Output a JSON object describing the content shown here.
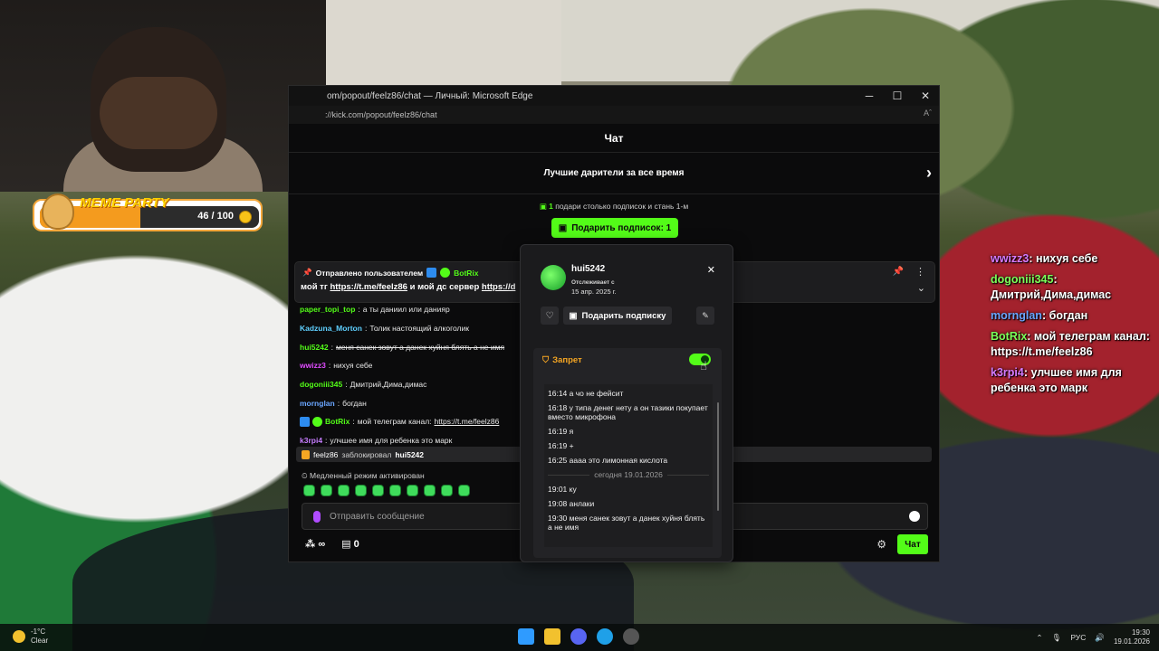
{
  "stream": {
    "meme_party": {
      "title": "MEME PARTY",
      "count": "46 / 100",
      "progress": 0.46
    },
    "overlay_chat": [
      {
        "user": "wwizz3",
        "text": "нихуя себе",
        "color": "#d67bff"
      },
      {
        "user": "dogoniii345",
        "text": "Дмитрий,Дима,димас",
        "color": "#7cff5a"
      },
      {
        "user": "mornglan",
        "text": "богдан",
        "color": "#6aa6ff"
      },
      {
        "user": "BotRix",
        "text": "мой телеграм канал: https://t.me/feelz86",
        "color": "#7cff5a"
      },
      {
        "user": "k3rpi4",
        "text": "улчшее имя для ребенка это марк",
        "color": "#d67bff"
      }
    ]
  },
  "browser": {
    "title": "om/popout/feelz86/chat — Личный: Microsoft Edge",
    "url": "://kick.com/popout/feelz86/chat",
    "reader_icon": "Aˆ"
  },
  "chat": {
    "title": "Чат",
    "top_gifters": "Лучшие дарители за все время",
    "promo_count": "1",
    "promo_text": "подари столько подписок и стань 1-м",
    "gift_button": "Подарить подписок: 1",
    "pinned": {
      "label": "Отправлено пользователем",
      "user": "BotRix",
      "text_start": "мой тг",
      "link1": "https://t.me/feelz86",
      "text_mid": "и мой дс сервер",
      "link2": "https://d"
    },
    "messages": [
      {
        "user": "paper_topi_top",
        "text": "а ты даниил или данияр",
        "color": "#53fc18"
      },
      {
        "user": "Kadzuna_Morton",
        "text": "Толик настоящий алкоголик",
        "color": "#5fd0ff"
      },
      {
        "user": "hui5242",
        "text": "меня санек зовут а данек хуйня блять а не имя",
        "color": "#53fc18",
        "struck": true
      },
      {
        "user": "wwizz3",
        "text": "нихуя себе",
        "color": "#e04cff"
      },
      {
        "user": "dogoniii345",
        "text": "Дмитрий,Дима,димас",
        "color": "#53fc18"
      },
      {
        "user": "mornglan",
        "text": "богдан",
        "color": "#6aa6ff"
      },
      {
        "user": "BotRix",
        "text": "мой телеграм канал:",
        "link": "https://t.me/feelz86",
        "color": "#53fc18"
      },
      {
        "user": "k3rpi4",
        "text": "улчшее имя для ребенка это марк",
        "color": "#c77dff"
      }
    ],
    "ban_notice": {
      "moderator": "feelz86",
      "action": "заблокировал",
      "target": "hui5242"
    },
    "slow_mode": "Медленный режим активирован",
    "input_placeholder": "Отправить сообщение",
    "footer": {
      "viewers": "∞",
      "store_count": "0",
      "send_label": "Чат"
    }
  },
  "user_card": {
    "username": "hui5242",
    "follow_label": "Отслеживает с",
    "follow_date": "15 апр. 2025 г.",
    "gift_button": "Подарить подписку",
    "ban_label": "Запрет",
    "ban_enabled": true,
    "history": [
      {
        "type": "msg",
        "text": "16:14 а чо не фейсит"
      },
      {
        "type": "msg",
        "text": "16:18 у типа денег нету а он тазики покупает вместо микрофона"
      },
      {
        "type": "msg",
        "text": "16:19 я"
      },
      {
        "type": "msg",
        "text": "16:19 +"
      },
      {
        "type": "msg",
        "text": "16:25 аааа это лимонная кислота"
      },
      {
        "type": "date",
        "text": "сегодня 19.01.2026"
      },
      {
        "type": "msg",
        "text": "19:01 ку"
      },
      {
        "type": "msg",
        "text": "19:08 анлаки"
      },
      {
        "type": "msg",
        "text": "19:30 меня санек зовут а данек хуйня блять а не имя"
      }
    ]
  },
  "taskbar": {
    "temperature": "-1°C",
    "weather": "Clear",
    "language": "РУС",
    "time": "19:30",
    "date": "19.01.2026"
  },
  "colors": {
    "kick_green": "#53fc18",
    "ban_orange": "#f5a623"
  }
}
